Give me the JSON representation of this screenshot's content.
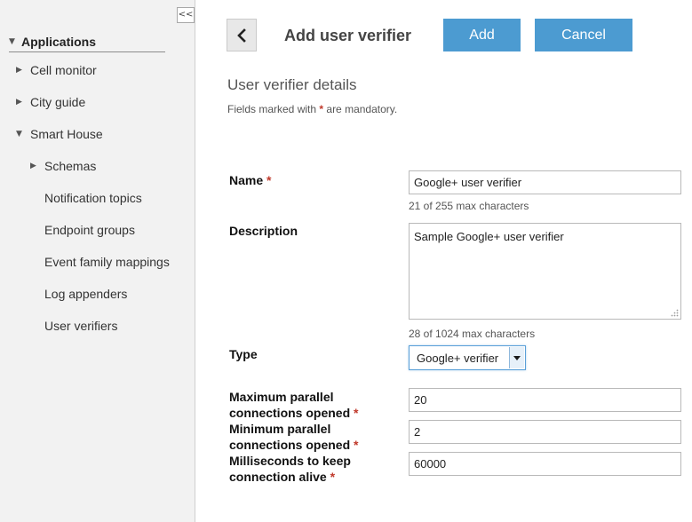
{
  "sidebar": {
    "collapse_label": "<<",
    "root": {
      "label": "Applications",
      "icon": "triangle-down-icon"
    },
    "items": [
      {
        "label": "Cell monitor",
        "icon": "triangle-right-icon"
      },
      {
        "label": "City guide",
        "icon": "triangle-right-icon"
      },
      {
        "label": "Smart House",
        "icon": "triangle-down-icon"
      },
      {
        "label": "Schemas",
        "icon": "triangle-right-icon"
      },
      {
        "label": "Notification topics"
      },
      {
        "label": "Endpoint groups"
      },
      {
        "label": "Event family mappings"
      },
      {
        "label": "Log appenders"
      },
      {
        "label": "User verifiers"
      }
    ]
  },
  "header": {
    "back_icon": "chevron-left-icon",
    "title": "Add user verifier",
    "add_label": "Add",
    "cancel_label": "Cancel"
  },
  "details": {
    "title": "User verifier details",
    "note_prefix": "Fields marked with",
    "note_star": "*",
    "note_suffix": "are mandatory."
  },
  "form": {
    "required_mark": "*",
    "name": {
      "label": "Name",
      "value": "Google+ user verifier",
      "hint": "21 of 255 max characters"
    },
    "description": {
      "label": "Description",
      "value": "Sample Google+ user verifier",
      "hint": "28 of 1024 max characters"
    },
    "type": {
      "label": "Type",
      "value": "Google+ verifier",
      "icon": "dropdown-arrow-icon"
    },
    "max_parallel": {
      "label_line1": "Maximum parallel",
      "label_line2": "connections opened",
      "value": "20"
    },
    "min_parallel": {
      "label_line1": "Minimum parallel",
      "label_line2": "connections opened",
      "value": "2"
    },
    "keep_alive": {
      "label_line1": "Milliseconds to keep",
      "label_line2": "connection alive",
      "value": "60000"
    }
  },
  "colors": {
    "accent": "#4c9bd1",
    "sidebar_bg": "#f2f2f2",
    "required": "#c0392b"
  }
}
